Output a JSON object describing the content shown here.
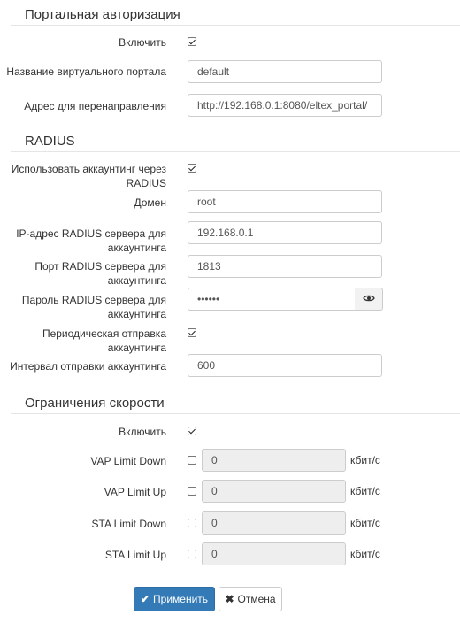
{
  "portal": {
    "title": "Портальная авторизация",
    "enable_label": "Включить",
    "enable_checked": true,
    "vname_label": "Название виртуального портала",
    "vname_value": "default",
    "redirect_label": "Адрес для перенаправления",
    "redirect_value": "http://192.168.0.1:8080/eltex_portal/"
  },
  "radius": {
    "title": "RADIUS",
    "use_acct_label": "Использовать аккаунтинг через RADIUS",
    "use_acct_checked": true,
    "domain_label": "Домен",
    "domain_value": "root",
    "ip_label": "IP-адрес RADIUS сервера для аккаунтинга",
    "ip_value": "192.168.0.1",
    "port_label": "Порт RADIUS сервера для аккаунтинга",
    "port_value": "1813",
    "password_label": "Пароль RADIUS сервера для аккаунтинга",
    "password_value": "••••••",
    "periodic_label": "Периодическая отправка аккаунтинга",
    "periodic_checked": true,
    "interval_label": "Интервал отправки аккаунтинга",
    "interval_value": "600"
  },
  "speed": {
    "title": "Ограничения скорости",
    "enable_label": "Включить",
    "enable_checked": true,
    "unit": "кбит/с",
    "vap_down_label": "VAP Limit Down",
    "vap_down_value": "0",
    "vap_up_label": "VAP Limit Up",
    "vap_up_value": "0",
    "sta_down_label": "STA Limit Down",
    "sta_down_value": "0",
    "sta_up_label": "STA Limit Up",
    "sta_up_value": "0"
  },
  "actions": {
    "apply_label": "Применить",
    "cancel_label": "Отмена"
  },
  "icons": {
    "check": "check-icon",
    "close": "close-icon",
    "eye": "eye-icon"
  }
}
